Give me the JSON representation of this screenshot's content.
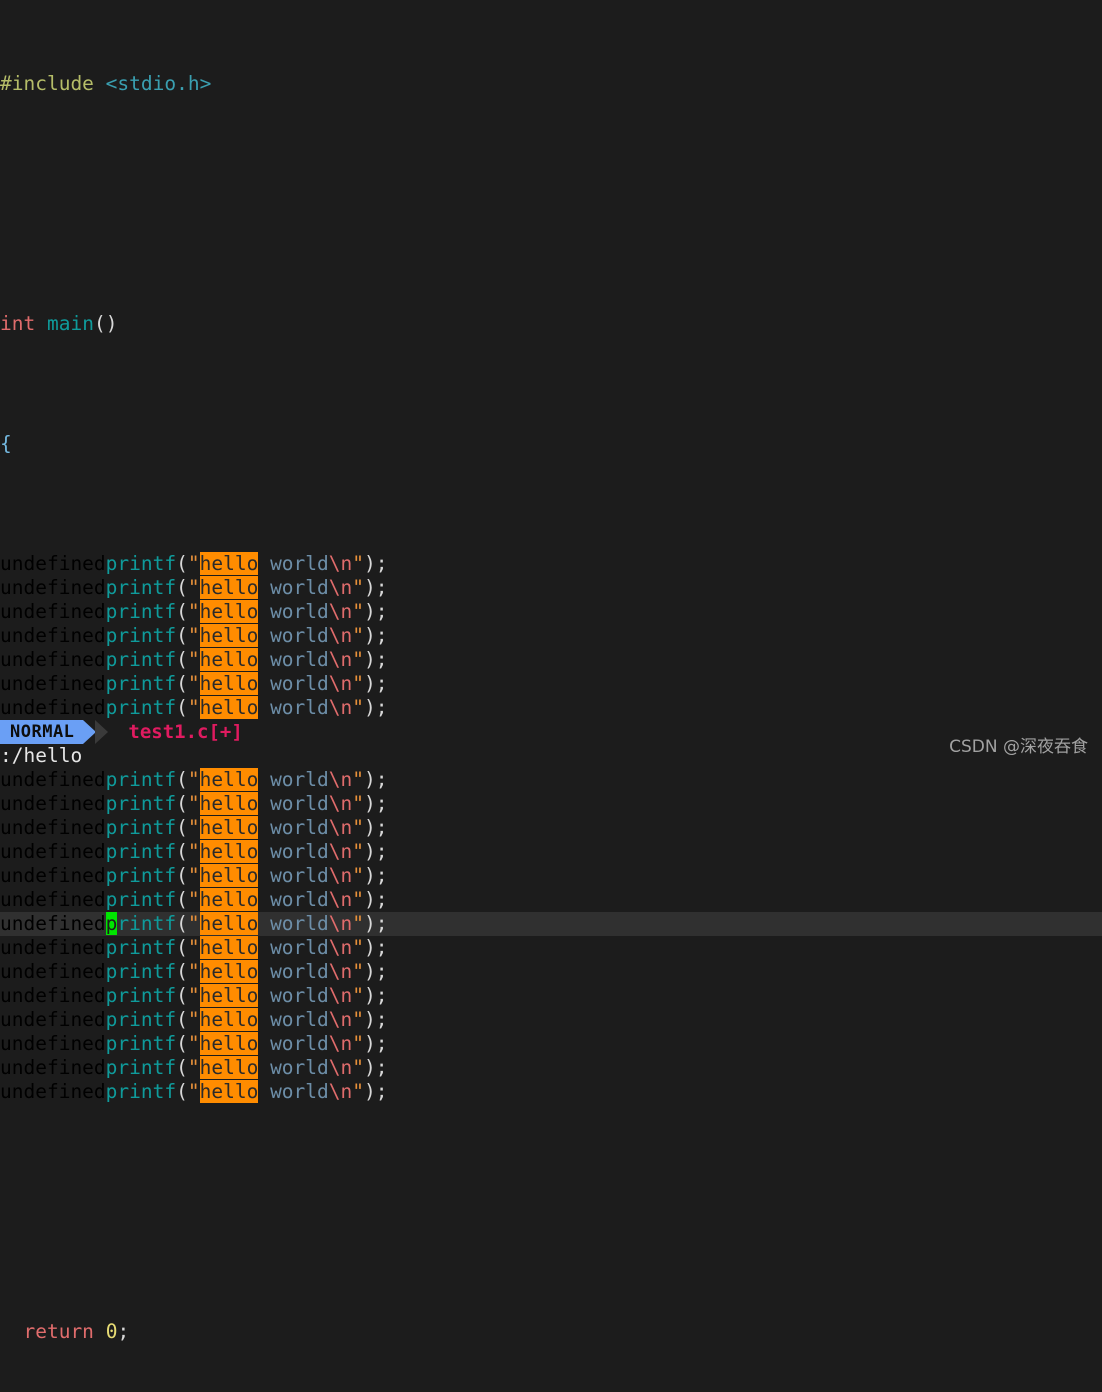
{
  "editor": {
    "app": "vim",
    "background_color": "#1c1c1c",
    "cursorline_color": "#303030",
    "search_highlight_color": "#ff8c00",
    "cursor_color": "#00e500",
    "indent": "  "
  },
  "code": {
    "line_1_include_directive": "#include",
    "line_1_header": "<stdio.h>",
    "line_3_type": "int",
    "line_3_name": "main",
    "line_3_parens": "()",
    "line_4_open_brace": "{",
    "printf_name": "printf",
    "paren_open": "(",
    "quote": "\"",
    "search_term": "hello",
    "string_rest": " world",
    "escape": "\\n",
    "paren_close": ")",
    "semicolon": ";",
    "return_keyword": "return",
    "return_value": "0",
    "printf_count": 23,
    "cursor_printf_index": 16,
    "cursor_char": "p"
  },
  "statusline": {
    "mode": "NORMAL",
    "filename": "test1.c[+]",
    "mode_bg": "#6a9ff5",
    "mode_fg": "#0d0d0d",
    "filename_color": "#e01b60"
  },
  "cmdline": {
    "text": ":/hello"
  },
  "watermark": {
    "text": "CSDN @深夜吞食"
  }
}
